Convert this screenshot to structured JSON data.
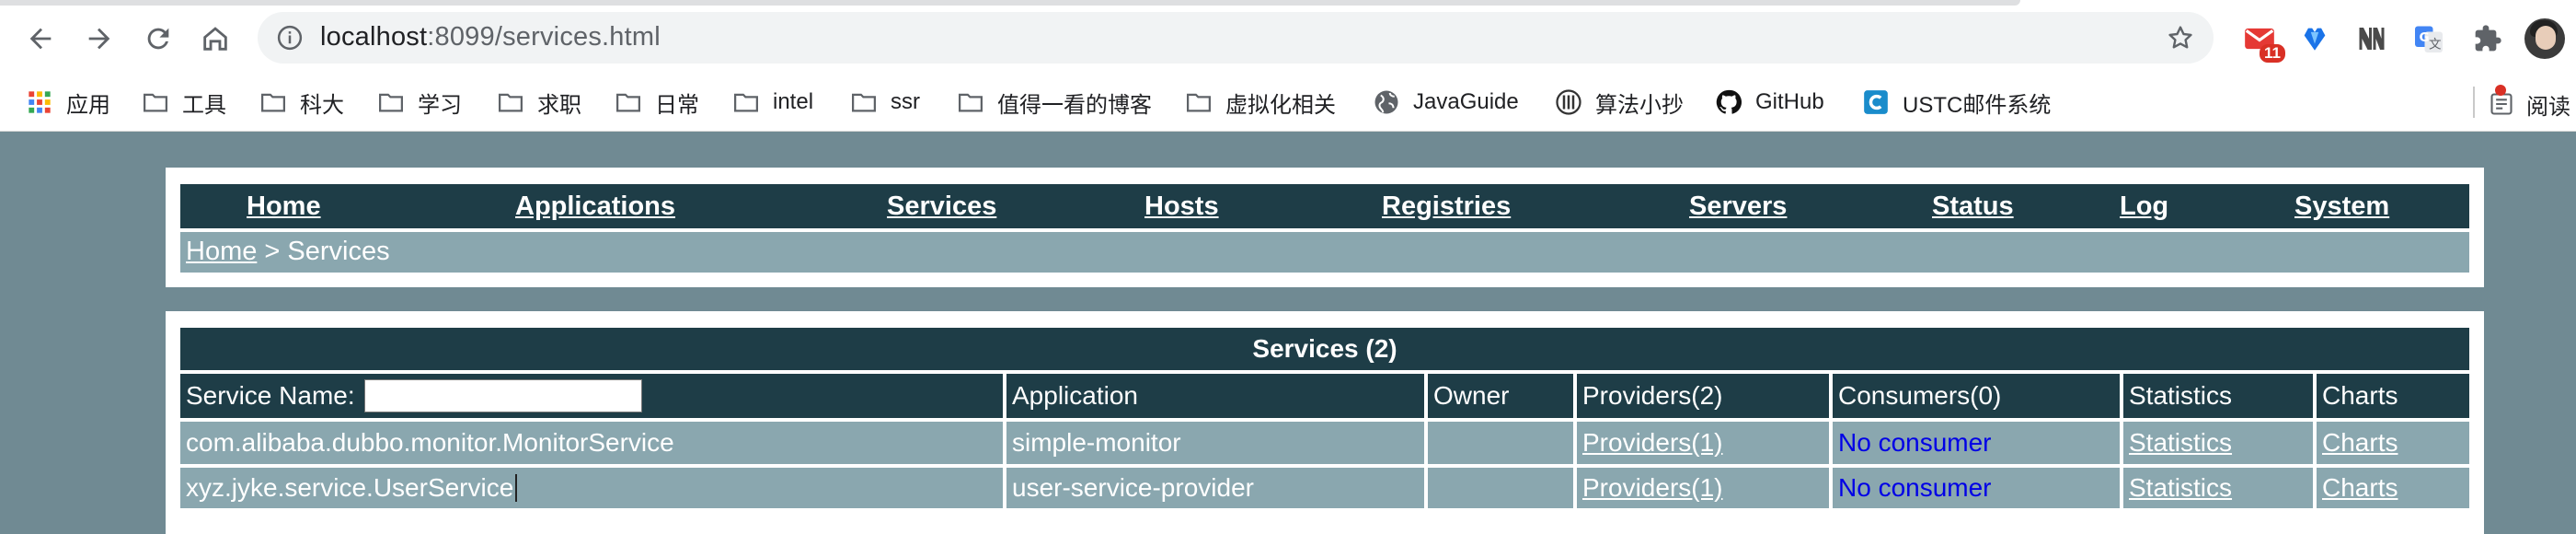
{
  "browser": {
    "url_host": "localhost",
    "url_path": ":8099/services.html",
    "gmail_badge": "11",
    "bookmarks": [
      {
        "label": "应用",
        "icon": "apps-grid-icon"
      },
      {
        "label": "工具",
        "icon": "folder-icon"
      },
      {
        "label": "科大",
        "icon": "folder-icon"
      },
      {
        "label": "学习",
        "icon": "folder-icon"
      },
      {
        "label": "求职",
        "icon": "folder-icon"
      },
      {
        "label": "日常",
        "icon": "folder-icon"
      },
      {
        "label": "intel",
        "icon": "folder-icon"
      },
      {
        "label": "ssr",
        "icon": "folder-icon"
      },
      {
        "label": "值得一看的博客",
        "icon": "folder-icon"
      },
      {
        "label": "虚拟化相关",
        "icon": "folder-icon"
      },
      {
        "label": "JavaGuide",
        "icon": "globe-icon"
      },
      {
        "label": "算法小抄",
        "icon": "algorithm-icon"
      },
      {
        "label": "GitHub",
        "icon": "github-icon"
      },
      {
        "label": "USTC邮件系统",
        "icon": "mail-c-icon"
      }
    ],
    "reading_list": "阅读"
  },
  "menu": {
    "home": "Home",
    "applications": "Applications",
    "services": "Services",
    "hosts": "Hosts",
    "registries": "Registries",
    "servers": "Servers",
    "status": "Status",
    "log": "Log",
    "system": "System"
  },
  "breadcrumb": {
    "home": "Home",
    "separator": " > ",
    "current": "Services"
  },
  "services": {
    "title": "Services (2)",
    "headers": {
      "service_name": "Service Name:",
      "application": "Application",
      "owner": "Owner",
      "providers": "Providers(2)",
      "consumers": "Consumers(0)",
      "statistics": "Statistics",
      "charts": "Charts"
    },
    "filter_value": "",
    "rows": [
      {
        "service": "com.alibaba.dubbo.monitor.MonitorService",
        "application": "simple-monitor",
        "owner": "",
        "providers": "Providers(1)",
        "consumers": "No consumer",
        "statistics": "Statistics",
        "charts": "Charts"
      },
      {
        "service": "xyz.jyke.service.UserService",
        "application": "user-service-provider",
        "owner": "",
        "providers": "Providers(1)",
        "consumers": "No consumer",
        "statistics": "Statistics",
        "charts": "Charts"
      }
    ]
  }
}
